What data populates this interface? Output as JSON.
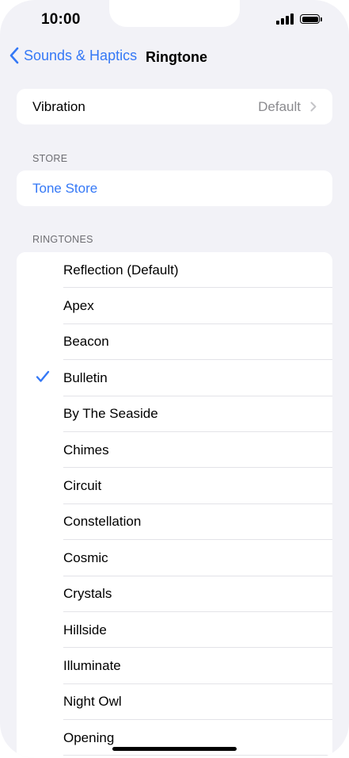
{
  "status_bar": {
    "time": "10:00",
    "signal_icon": "cellular-signal-icon",
    "battery_icon": "battery-full-icon"
  },
  "nav": {
    "back_label": "Sounds & Haptics",
    "back_icon": "chevron-left-icon",
    "title": "Ringtone"
  },
  "vibration": {
    "label": "Vibration",
    "value": "Default",
    "chevron_icon": "chevron-right-icon"
  },
  "store": {
    "header": "STORE",
    "tone_store_label": "Tone Store"
  },
  "ringtones": {
    "header": "RINGTONES",
    "selected": "Bulletin",
    "items": [
      {
        "label": "Reflection (Default)",
        "selected": false
      },
      {
        "label": "Apex",
        "selected": false
      },
      {
        "label": "Beacon",
        "selected": false
      },
      {
        "label": "Bulletin",
        "selected": true
      },
      {
        "label": "By The Seaside",
        "selected": false
      },
      {
        "label": "Chimes",
        "selected": false
      },
      {
        "label": "Circuit",
        "selected": false
      },
      {
        "label": "Constellation",
        "selected": false
      },
      {
        "label": "Cosmic",
        "selected": false
      },
      {
        "label": "Crystals",
        "selected": false
      },
      {
        "label": "Hillside",
        "selected": false
      },
      {
        "label": "Illuminate",
        "selected": false
      },
      {
        "label": "Night Owl",
        "selected": false
      },
      {
        "label": "Opening",
        "selected": false
      }
    ]
  },
  "colors": {
    "accent": "#3478f6",
    "background": "#f2f2f7",
    "card": "#ffffff",
    "secondary_text": "#8a8a8e"
  }
}
